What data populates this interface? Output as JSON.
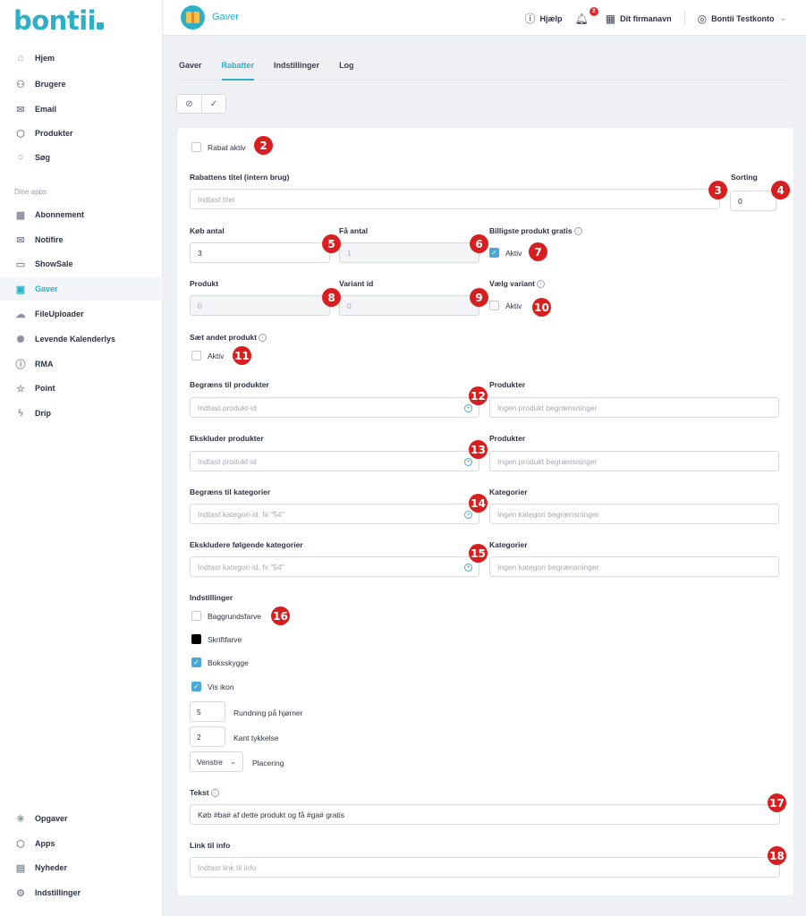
{
  "logo": "bontii",
  "sidebar": {
    "items": [
      {
        "label": "Hjem",
        "icon": "home-icon"
      },
      {
        "label": "Brugere",
        "icon": "users-icon"
      },
      {
        "label": "Email",
        "icon": "mail-icon"
      },
      {
        "label": "Produkter",
        "icon": "box-icon"
      },
      {
        "label": "Søg",
        "icon": "search-icon"
      }
    ],
    "section_label": "Dine apps",
    "apps": [
      {
        "label": "Abonnement",
        "icon": "calendar-icon"
      },
      {
        "label": "Notifire",
        "icon": "envelope-open-icon"
      },
      {
        "label": "ShowSale",
        "icon": "chat-icon"
      },
      {
        "label": "Gaver",
        "icon": "gift-icon"
      },
      {
        "label": "FileUploader",
        "icon": "upload-icon"
      },
      {
        "label": "Levende Kalenderlys",
        "icon": "sun-icon"
      },
      {
        "label": "RMA",
        "icon": "alert-icon"
      },
      {
        "label": "Point",
        "icon": "star-icon"
      },
      {
        "label": "Drip",
        "icon": "bolt-icon"
      }
    ],
    "bottom": [
      {
        "label": "Opgaver",
        "icon": "tasks-icon"
      },
      {
        "label": "Apps",
        "icon": "cube-icon"
      },
      {
        "label": "Nyheder",
        "icon": "news-icon"
      },
      {
        "label": "Indstillinger",
        "icon": "gear-icon"
      }
    ]
  },
  "topbar": {
    "app_title": "Gaver",
    "help": "Hjælp",
    "notifications_count": "2",
    "company": "Dit firmanavn",
    "account": "Bontii Testkonto"
  },
  "tabs": [
    "Gaver",
    "Rabatter",
    "Indstillinger",
    "Log"
  ],
  "form": {
    "rabat_aktiv": "Rabat aktiv",
    "titel_label": "Rabattens titel (intern brug)",
    "titel_placeholder": "Indtast titel",
    "sorting_label": "Sorting",
    "sorting_value": "0",
    "koeb_antal_label": "Køb antal",
    "koeb_antal_value": "3",
    "faa_antal_label": "Få antal",
    "faa_antal_value": "1",
    "billigste_label": "Billigste produkt gratis",
    "aktiv": "Aktiv",
    "produkt_label": "Produkt",
    "produkt_value": "0",
    "variant_label": "Variant id",
    "variant_value": "0",
    "vaelg_variant_label": "Vælg variant",
    "saet_andet_label": "Sæt andet produkt",
    "begraens_produkter_label": "Begræns til produkter",
    "produkt_id_placeholder": "Indtast produkt-id",
    "produkter_label": "Produkter",
    "ingen_produkt": "Ingen produkt begrænsninger",
    "ekskluder_produkter_label": "Ekskluder produkter",
    "begraens_kategorier_label": "Begræns til kategorier",
    "kategori_placeholder": "Indtast kategori-id, fx \"54\"",
    "kategorier_label": "Kategorier",
    "ingen_kategori": "Ingen kategori begrænsninger",
    "ekskludere_kategorier_label": "Ekskludere følgende kategorier",
    "indstillinger_label": "Indstillinger",
    "baggrundsfarve": "Baggrundsfarve",
    "skriftfarve": "Skriftfarve",
    "boksskygge": "Boksskygge",
    "vis_ikon": "Vis ikon",
    "rundning_value": "5",
    "rundning_label": "Rundning på hjørner",
    "kant_value": "2",
    "kant_label": "Kant tykkelse",
    "placering_value": "Venstre",
    "placering_label": "Placering",
    "tekst_label": "Tekst",
    "tekst_value": "Køb #ba# af dette produkt og få #ga# gratis",
    "link_label": "Link til info",
    "link_placeholder": "Indtast link til info"
  },
  "markers": [
    "2",
    "3",
    "4",
    "5",
    "6",
    "7",
    "8",
    "9",
    "10",
    "11",
    "12",
    "13",
    "14",
    "15",
    "16",
    "17",
    "18"
  ],
  "colors": {
    "accent": "#2bb0c7",
    "marker": "#d81f1f",
    "checkbox": "#4aa8d8"
  }
}
